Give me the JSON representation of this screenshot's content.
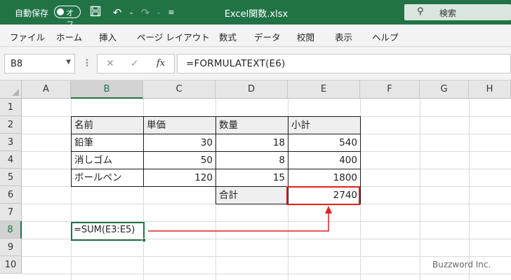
{
  "titlebar": {
    "autosave_label": "自動保存",
    "autosave_state": "オフ",
    "doc_title": "Excel関数.xlsx",
    "search_label": "検索"
  },
  "ribbon": {
    "tabs": [
      "ファイル",
      "ホーム",
      "挿入",
      "ページ レイアウト",
      "数式",
      "データ",
      "校閲",
      "表示",
      "ヘルプ"
    ]
  },
  "formula_bar": {
    "name_box": "B8",
    "fx_label": "fx",
    "formula": "=FORMULATEXT(E6)"
  },
  "grid": {
    "columns": [
      "A",
      "B",
      "C",
      "D",
      "E",
      "F",
      "G",
      "H"
    ],
    "rows": [
      "1",
      "2",
      "3",
      "4",
      "5",
      "6",
      "7",
      "8",
      "9",
      "10"
    ],
    "selected_column": "B",
    "selected_row": "8"
  },
  "table": {
    "headers": [
      "名前",
      "単価",
      "数量",
      "小計"
    ],
    "rows": [
      [
        "鉛筆",
        "30",
        "18",
        "540"
      ],
      [
        "消しゴム",
        "50",
        "8",
        "400"
      ],
      [
        "ボールペン",
        "120",
        "15",
        "1800"
      ]
    ],
    "total_label": "合計",
    "total_value": "2740"
  },
  "result_cell": {
    "value": "=SUM(E3:E5)"
  },
  "colors": {
    "accent": "#217346",
    "highlight": "#e02020"
  },
  "icons": [
    "save-icon",
    "undo-icon",
    "redo-icon",
    "customize-qat-icon",
    "search-icon",
    "cancel-icon",
    "enter-icon",
    "fx-icon"
  ],
  "watermark": "Buzzword Inc."
}
